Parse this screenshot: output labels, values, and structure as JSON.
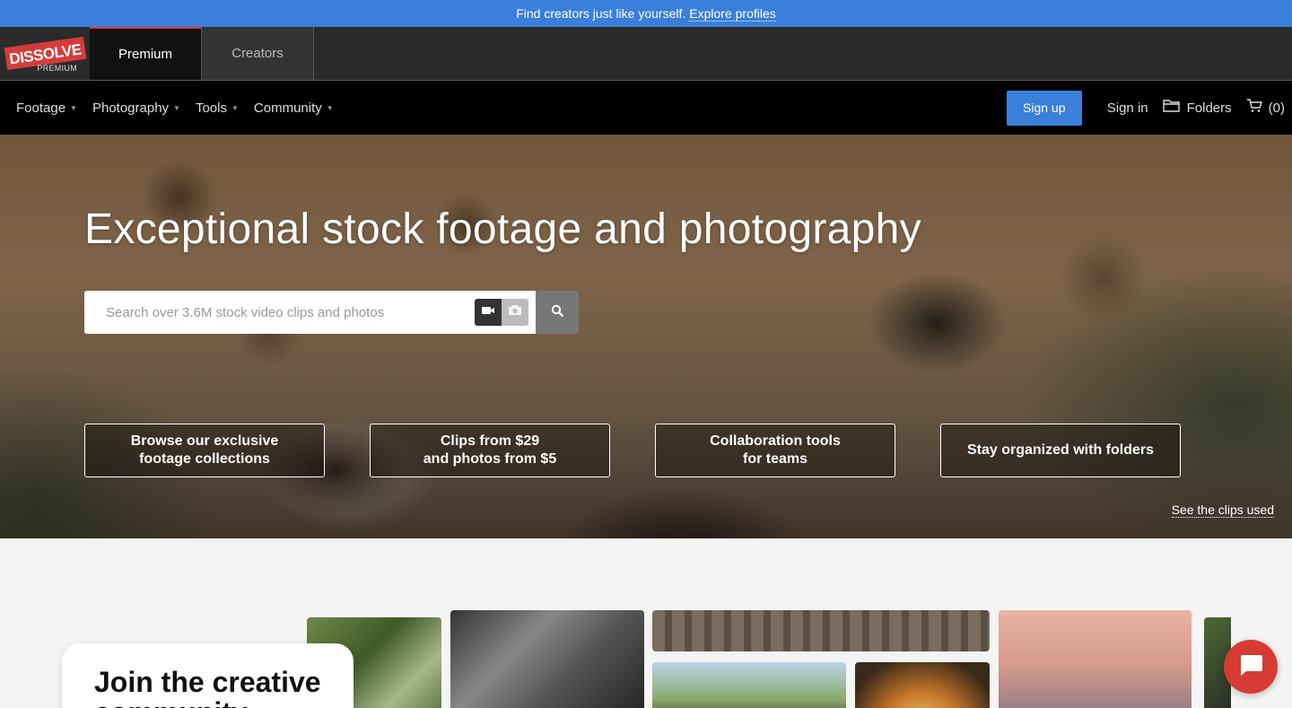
{
  "announcement": {
    "text": "Find creators just like yourself.",
    "link": "Explore profiles"
  },
  "brand": {
    "logo_text": "DISSOLVE",
    "logo_sub": "PREMIUM",
    "tabs": [
      {
        "label": "Premium",
        "active": true
      },
      {
        "label": "Creators",
        "active": false
      }
    ]
  },
  "nav": {
    "menu": [
      {
        "label": "Footage",
        "icon": "caret-down"
      },
      {
        "label": "Photography",
        "icon": "caret-down"
      },
      {
        "label": "Tools",
        "icon": "caret-down"
      },
      {
        "label": "Community",
        "icon": "caret-down"
      }
    ],
    "signup": "Sign up",
    "signin": "Sign in",
    "folders": "Folders",
    "cart": "(0)"
  },
  "hero": {
    "title": "Exceptional stock footage and photography",
    "search_placeholder": "Search over 3.6M stock video clips and photos",
    "features": [
      {
        "line1": "Browse our exclusive",
        "line2": "footage collections"
      },
      {
        "line1": "Clips from $29",
        "line2": "and photos from $5"
      },
      {
        "line1": "Collaboration tools",
        "line2": "for teams"
      },
      {
        "line1": "Stay organized with folders",
        "line2": ""
      }
    ],
    "see_clips": "See the clips used"
  },
  "community": {
    "title": "Join the creative community"
  },
  "colors": {
    "accent_blue": "#3a7fd9",
    "brand_red": "#d43c3c",
    "chat_red": "#d63b34"
  }
}
